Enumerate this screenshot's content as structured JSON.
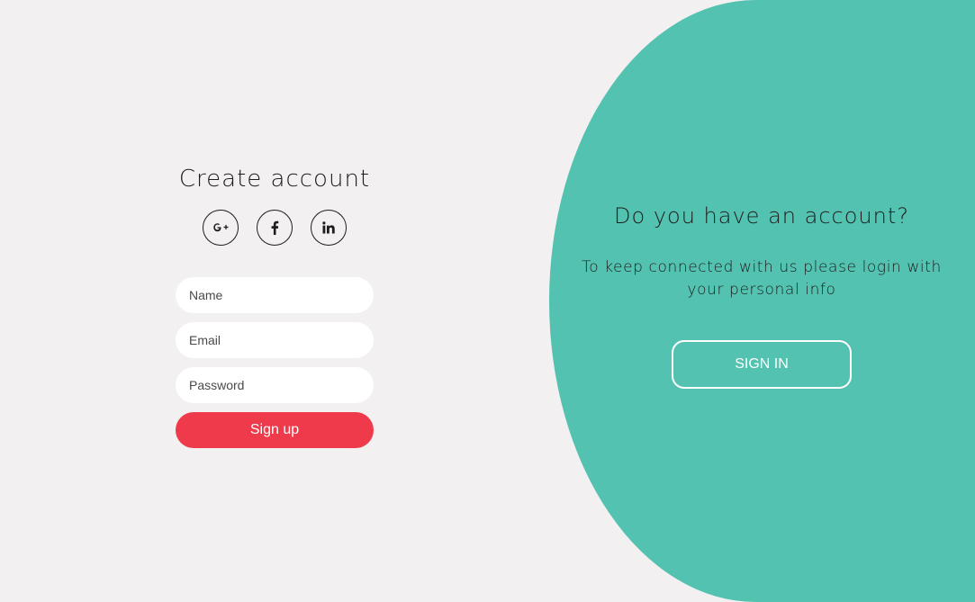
{
  "signup": {
    "title": "Create account",
    "social": [
      {
        "label": "G+",
        "icon": "google-plus-icon"
      },
      {
        "label": "f",
        "icon": "facebook-icon"
      },
      {
        "label": "in",
        "icon": "linkedin-icon"
      }
    ],
    "fields": {
      "name_placeholder": "Name",
      "email_placeholder": "Email",
      "password_placeholder": "Password"
    },
    "submit_label": "Sign up"
  },
  "overlay": {
    "title": "Do you have an account?",
    "text": "To keep connected with us please login with your personal info",
    "button_label": "SIGN IN"
  },
  "colors": {
    "background": "#f2f0f0",
    "accent_teal": "#54c2b0",
    "signup_red": "#ee3a4a",
    "text_dark": "#1d1d1d"
  }
}
